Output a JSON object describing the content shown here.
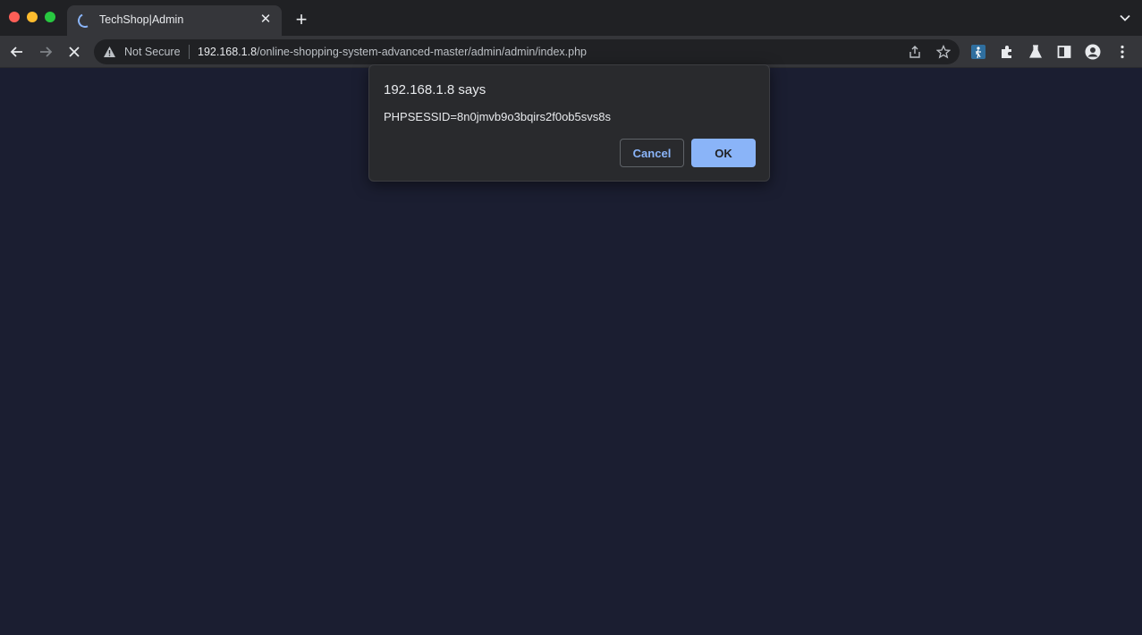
{
  "tab": {
    "title": "TechShop|Admin",
    "close": "✕",
    "new_tab": "+"
  },
  "omnibox": {
    "security_label": "Not Secure",
    "url_host": "192.168.1.8",
    "url_path": "/online-shopping-system-advanced-master/admin/admin/index.php"
  },
  "dialog": {
    "title": "192.168.1.8 says",
    "message": "PHPSESSID=8n0jmvb9o3bqirs2f0ob5svs8s",
    "cancel_label": "Cancel",
    "ok_label": "OK"
  },
  "colors": {
    "page_background": "#1b1e31",
    "accent": "#8ab4f8"
  },
  "icons": [
    "loading-spinner-icon",
    "close-icon",
    "plus-icon",
    "chevron-down-icon",
    "back-arrow-icon",
    "forward-arrow-icon",
    "stop-icon",
    "warning-icon",
    "share-icon",
    "star-icon",
    "extension-icon",
    "puzzle-icon",
    "flask-icon",
    "side-panel-icon",
    "profile-icon",
    "more-vert-icon"
  ]
}
